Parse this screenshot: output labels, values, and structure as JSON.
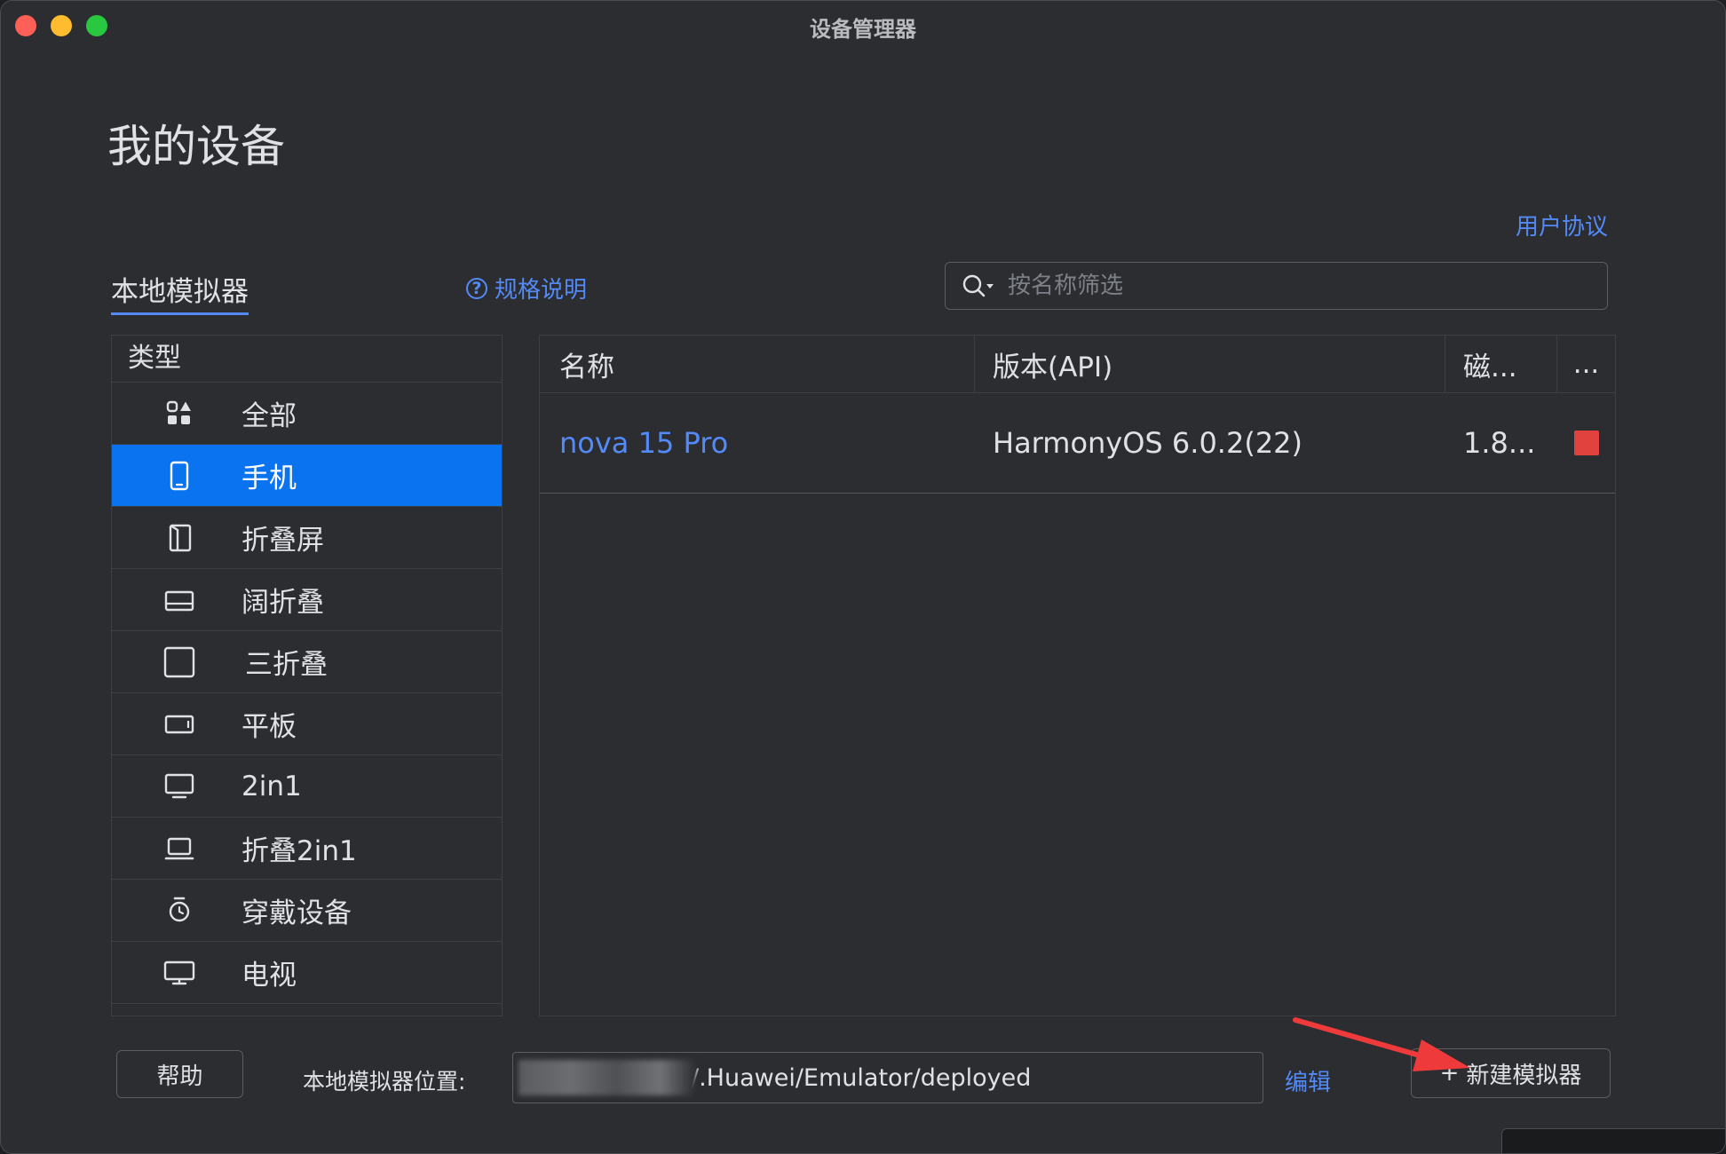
{
  "window": {
    "title": "设备管理器"
  },
  "page": {
    "title": "我的设备",
    "user_agreement": "用户协议"
  },
  "tabs": {
    "local_emulator": "本地模拟器"
  },
  "spec_link": {
    "label": "规格说明"
  },
  "search": {
    "placeholder": "按名称筛选"
  },
  "type_panel": {
    "header": "类型",
    "items": [
      {
        "label": "全部",
        "icon": "all-grid-icon",
        "selected": false
      },
      {
        "label": "手机",
        "icon": "phone-icon",
        "selected": true
      },
      {
        "label": "折叠屏",
        "icon": "foldable-icon",
        "selected": false
      },
      {
        "label": "阔折叠",
        "icon": "wide-fold-icon",
        "selected": false
      },
      {
        "label": "三折叠",
        "icon": "tri-fold-icon",
        "selected": false
      },
      {
        "label": "平板",
        "icon": "tablet-icon",
        "selected": false
      },
      {
        "label": "2in1",
        "icon": "monitor-icon",
        "selected": false
      },
      {
        "label": "折叠2in1",
        "icon": "laptop-icon",
        "selected": false
      },
      {
        "label": "穿戴设备",
        "icon": "watch-icon",
        "selected": false
      },
      {
        "label": "电视",
        "icon": "tv-icon",
        "selected": false
      }
    ]
  },
  "device_table": {
    "columns": {
      "name": "名称",
      "version": "版本(API)",
      "disk": "磁...",
      "more": "..."
    },
    "rows": [
      {
        "name": "nova 15 Pro",
        "version": "HarmonyOS 6.0.2(22)",
        "disk": "1.8...",
        "action_icon": "stop-icon"
      }
    ]
  },
  "bottom": {
    "help": "帮助",
    "location_label": "本地模拟器位置:",
    "location_value": "/.Huawei/Emulator/deployed",
    "edit": "编辑",
    "new_emulator": "新建模拟器",
    "new_emulator_icon": "+"
  },
  "colors": {
    "accent": "#548af7",
    "selected": "#0a73ef",
    "stop": "#e2423e",
    "annotation_arrow": "#ee3a3a"
  }
}
